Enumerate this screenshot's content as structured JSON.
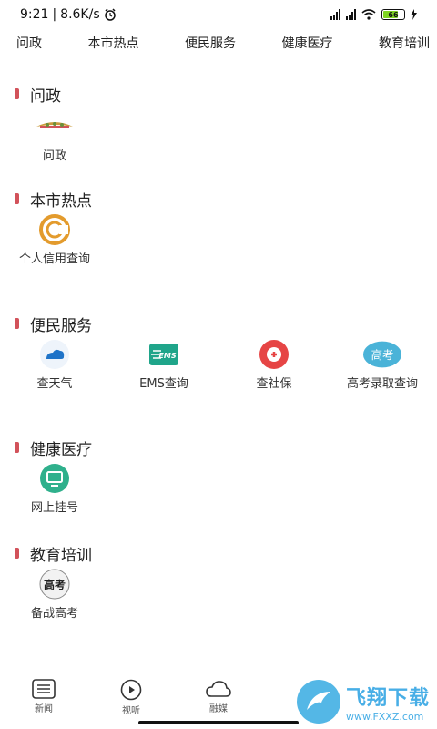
{
  "status": {
    "time": "9:21",
    "speed": "8.6K/s",
    "battery": "66"
  },
  "tabs": [
    "问政",
    "本市热点",
    "便民服务",
    "健康医疗",
    "教育培训"
  ],
  "sections": [
    {
      "title": "问政",
      "items": [
        {
          "label": "问政",
          "icon": "government-badge-icon"
        }
      ]
    },
    {
      "title": "本市热点",
      "items": [
        {
          "label": "个人信用查询",
          "icon": "credit-icon"
        }
      ]
    },
    {
      "title": "便民服务",
      "items": [
        {
          "label": "查天气",
          "icon": "weather-icon"
        },
        {
          "label": "EMS查询",
          "icon": "ems-icon"
        },
        {
          "label": "查社保",
          "icon": "social-security-icon"
        },
        {
          "label": "高考录取查询",
          "icon": "gaokao-icon",
          "icon_text": "高考"
        }
      ]
    },
    {
      "title": "健康医疗",
      "items": [
        {
          "label": "网上挂号",
          "icon": "monitor-icon"
        }
      ]
    },
    {
      "title": "教育培训",
      "items": [
        {
          "label": "备战高考",
          "icon": "exam-seal-icon",
          "icon_text": "高考"
        }
      ]
    }
  ],
  "bottom_nav": [
    {
      "label": "新闻",
      "icon": "list-icon"
    },
    {
      "label": "视听",
      "icon": "play-icon"
    },
    {
      "label": "融媒",
      "icon": "cloud-icon"
    }
  ],
  "watermark": {
    "title": "飞翔下载",
    "url": "www.FXXZ.com"
  },
  "colors": {
    "accent": "#d2525a",
    "weather": "#1e73c8",
    "ems": "#1fa58a",
    "social": "#e64545",
    "gaokao": "#4ab3d8",
    "health": "#2fb08c"
  }
}
